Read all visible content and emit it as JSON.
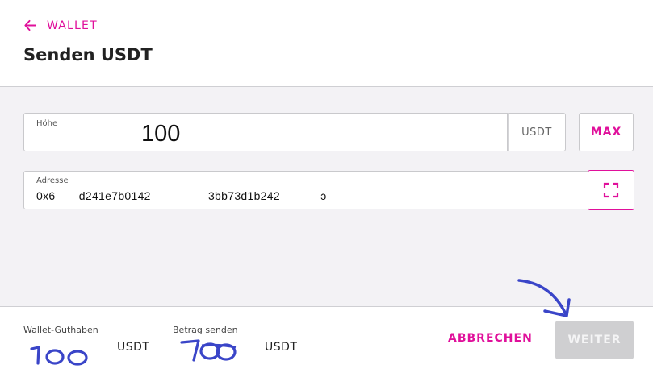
{
  "header": {
    "back_label": "WALLET",
    "title": "Senden USDT"
  },
  "amount": {
    "label": "Höhe",
    "value": "100",
    "unit": "USDT",
    "max_label": "MAX"
  },
  "address": {
    "label": "Adresse",
    "value": "0x6       d241e7b0142                 3bb73d1b242            ɔ"
  },
  "footer": {
    "balance_label": "Wallet-Guthaben",
    "balance_unit": "USDT",
    "send_label": "Betrag senden",
    "send_unit": "USDT",
    "cancel_label": "ABBRECHEN",
    "next_label": "WEITER"
  },
  "colors": {
    "accent": "#e0109b",
    "disabled_button": "#cfcfd1",
    "annotation_ink": "#3a45c8"
  }
}
